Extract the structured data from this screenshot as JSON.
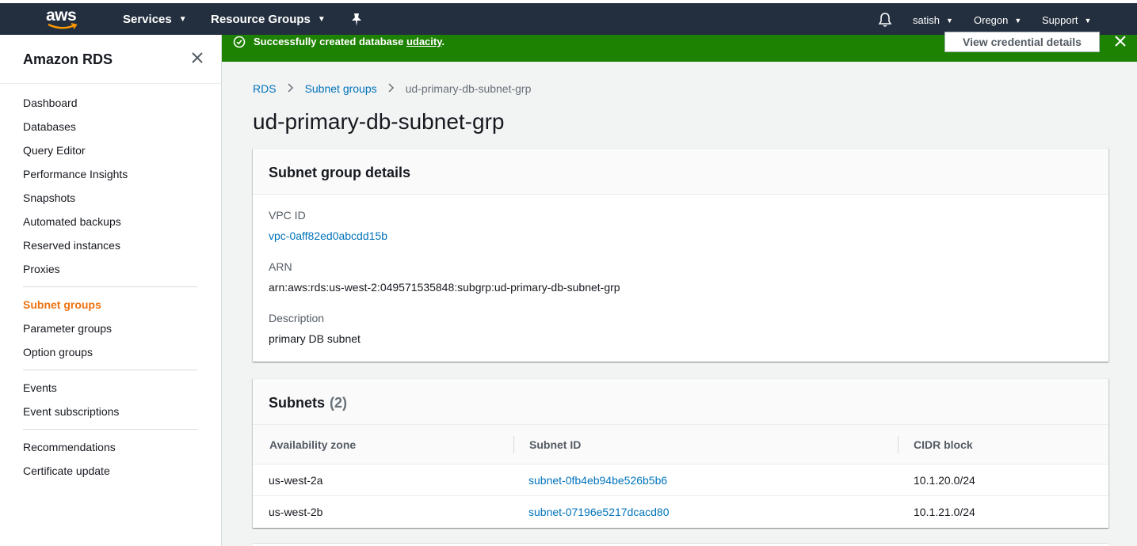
{
  "topnav": {
    "logo_text": "aws",
    "services_label": "Services",
    "resource_groups_label": "Resource Groups",
    "pin_icon": "pushpin-icon",
    "bell_icon": "bell-icon",
    "user_label": "satish",
    "region_label": "Oregon",
    "support_label": "Support"
  },
  "sidebar": {
    "title": "Amazon RDS",
    "items": [
      {
        "label": "Dashboard"
      },
      {
        "label": "Databases"
      },
      {
        "label": "Query Editor"
      },
      {
        "label": "Performance Insights"
      },
      {
        "label": "Snapshots"
      },
      {
        "label": "Automated backups"
      },
      {
        "label": "Reserved instances"
      },
      {
        "label": "Proxies"
      },
      {
        "label": "Subnet groups",
        "active": true
      },
      {
        "label": "Parameter groups"
      },
      {
        "label": "Option groups"
      },
      {
        "label": "Events"
      },
      {
        "label": "Event subscriptions"
      },
      {
        "label": "Recommendations"
      },
      {
        "label": "Certificate update"
      }
    ]
  },
  "flash": {
    "prefix": "Successfully created database ",
    "db_link": "udacity",
    "suffix": ".",
    "button_label": "View credential details",
    "color": "#1d8102"
  },
  "breadcrumb": {
    "root": "RDS",
    "parent": "Subnet groups",
    "current": "ud-primary-db-subnet-grp"
  },
  "page_title": "ud-primary-db-subnet-grp",
  "details": {
    "title": "Subnet group details",
    "vpc_label": "VPC ID",
    "vpc_value": "vpc-0aff82ed0abcdd15b",
    "arn_label": "ARN",
    "arn_value": "arn:aws:rds:us-west-2:049571535848:subgrp:ud-primary-db-subnet-grp",
    "description_label": "Description",
    "description_value": "primary DB subnet"
  },
  "subnets": {
    "title": "Subnets",
    "count": "(2)",
    "columns": [
      "Availability zone",
      "Subnet ID",
      "CIDR block"
    ],
    "rows": [
      {
        "zone": "us-west-2a",
        "subnet_id": "subnet-0fb4eb94be526b5b6",
        "cidr": "10.1.20.0/24"
      },
      {
        "zone": "us-west-2b",
        "subnet_id": "subnet-07196e5217dcacd80",
        "cidr": "10.1.21.0/24"
      }
    ]
  }
}
